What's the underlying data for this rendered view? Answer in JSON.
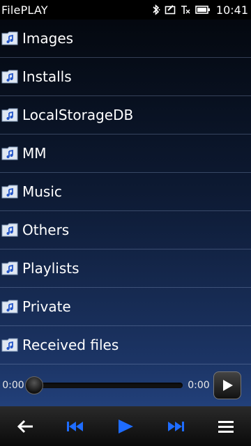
{
  "status": {
    "app_title": "FilePLAY",
    "time": "10:41"
  },
  "folders": [
    {
      "label": "Images"
    },
    {
      "label": "Installs"
    },
    {
      "label": "LocalStorageDB"
    },
    {
      "label": "MM"
    },
    {
      "label": "Music"
    },
    {
      "label": "Others"
    },
    {
      "label": "Playlists"
    },
    {
      "label": "Private"
    },
    {
      "label": "Received files"
    }
  ],
  "player": {
    "elapsed": "0:00",
    "duration": "0:00",
    "progress": 0
  },
  "toolbar": {
    "back_icon": "back-arrow-icon",
    "prev_icon": "skip-previous-icon",
    "play_icon": "play-icon",
    "next_icon": "skip-next-icon",
    "menu_icon": "menu-icon"
  },
  "colors": {
    "accent_blue": "#1e6cff",
    "list_top": "#04080f",
    "list_bottom": "#1c3566"
  }
}
